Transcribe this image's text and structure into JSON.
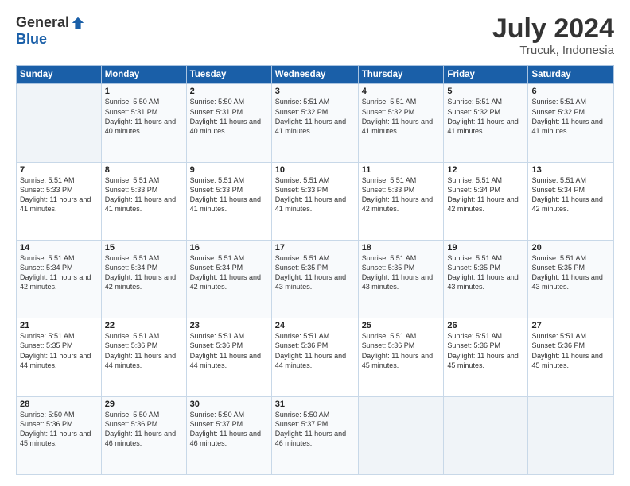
{
  "header": {
    "logo_general": "General",
    "logo_blue": "Blue",
    "month_year": "July 2024",
    "location": "Trucuk, Indonesia"
  },
  "weekdays": [
    "Sunday",
    "Monday",
    "Tuesday",
    "Wednesday",
    "Thursday",
    "Friday",
    "Saturday"
  ],
  "weeks": [
    [
      {
        "day": "",
        "sunrise": "",
        "sunset": "",
        "daylight": ""
      },
      {
        "day": "1",
        "sunrise": "Sunrise: 5:50 AM",
        "sunset": "Sunset: 5:31 PM",
        "daylight": "Daylight: 11 hours and 40 minutes."
      },
      {
        "day": "2",
        "sunrise": "Sunrise: 5:50 AM",
        "sunset": "Sunset: 5:31 PM",
        "daylight": "Daylight: 11 hours and 40 minutes."
      },
      {
        "day": "3",
        "sunrise": "Sunrise: 5:51 AM",
        "sunset": "Sunset: 5:32 PM",
        "daylight": "Daylight: 11 hours and 41 minutes."
      },
      {
        "day": "4",
        "sunrise": "Sunrise: 5:51 AM",
        "sunset": "Sunset: 5:32 PM",
        "daylight": "Daylight: 11 hours and 41 minutes."
      },
      {
        "day": "5",
        "sunrise": "Sunrise: 5:51 AM",
        "sunset": "Sunset: 5:32 PM",
        "daylight": "Daylight: 11 hours and 41 minutes."
      },
      {
        "day": "6",
        "sunrise": "Sunrise: 5:51 AM",
        "sunset": "Sunset: 5:32 PM",
        "daylight": "Daylight: 11 hours and 41 minutes."
      }
    ],
    [
      {
        "day": "7",
        "sunrise": "Sunrise: 5:51 AM",
        "sunset": "Sunset: 5:33 PM",
        "daylight": "Daylight: 11 hours and 41 minutes."
      },
      {
        "day": "8",
        "sunrise": "Sunrise: 5:51 AM",
        "sunset": "Sunset: 5:33 PM",
        "daylight": "Daylight: 11 hours and 41 minutes."
      },
      {
        "day": "9",
        "sunrise": "Sunrise: 5:51 AM",
        "sunset": "Sunset: 5:33 PM",
        "daylight": "Daylight: 11 hours and 41 minutes."
      },
      {
        "day": "10",
        "sunrise": "Sunrise: 5:51 AM",
        "sunset": "Sunset: 5:33 PM",
        "daylight": "Daylight: 11 hours and 41 minutes."
      },
      {
        "day": "11",
        "sunrise": "Sunrise: 5:51 AM",
        "sunset": "Sunset: 5:33 PM",
        "daylight": "Daylight: 11 hours and 42 minutes."
      },
      {
        "day": "12",
        "sunrise": "Sunrise: 5:51 AM",
        "sunset": "Sunset: 5:34 PM",
        "daylight": "Daylight: 11 hours and 42 minutes."
      },
      {
        "day": "13",
        "sunrise": "Sunrise: 5:51 AM",
        "sunset": "Sunset: 5:34 PM",
        "daylight": "Daylight: 11 hours and 42 minutes."
      }
    ],
    [
      {
        "day": "14",
        "sunrise": "Sunrise: 5:51 AM",
        "sunset": "Sunset: 5:34 PM",
        "daylight": "Daylight: 11 hours and 42 minutes."
      },
      {
        "day": "15",
        "sunrise": "Sunrise: 5:51 AM",
        "sunset": "Sunset: 5:34 PM",
        "daylight": "Daylight: 11 hours and 42 minutes."
      },
      {
        "day": "16",
        "sunrise": "Sunrise: 5:51 AM",
        "sunset": "Sunset: 5:34 PM",
        "daylight": "Daylight: 11 hours and 42 minutes."
      },
      {
        "day": "17",
        "sunrise": "Sunrise: 5:51 AM",
        "sunset": "Sunset: 5:35 PM",
        "daylight": "Daylight: 11 hours and 43 minutes."
      },
      {
        "day": "18",
        "sunrise": "Sunrise: 5:51 AM",
        "sunset": "Sunset: 5:35 PM",
        "daylight": "Daylight: 11 hours and 43 minutes."
      },
      {
        "day": "19",
        "sunrise": "Sunrise: 5:51 AM",
        "sunset": "Sunset: 5:35 PM",
        "daylight": "Daylight: 11 hours and 43 minutes."
      },
      {
        "day": "20",
        "sunrise": "Sunrise: 5:51 AM",
        "sunset": "Sunset: 5:35 PM",
        "daylight": "Daylight: 11 hours and 43 minutes."
      }
    ],
    [
      {
        "day": "21",
        "sunrise": "Sunrise: 5:51 AM",
        "sunset": "Sunset: 5:35 PM",
        "daylight": "Daylight: 11 hours and 44 minutes."
      },
      {
        "day": "22",
        "sunrise": "Sunrise: 5:51 AM",
        "sunset": "Sunset: 5:36 PM",
        "daylight": "Daylight: 11 hours and 44 minutes."
      },
      {
        "day": "23",
        "sunrise": "Sunrise: 5:51 AM",
        "sunset": "Sunset: 5:36 PM",
        "daylight": "Daylight: 11 hours and 44 minutes."
      },
      {
        "day": "24",
        "sunrise": "Sunrise: 5:51 AM",
        "sunset": "Sunset: 5:36 PM",
        "daylight": "Daylight: 11 hours and 44 minutes."
      },
      {
        "day": "25",
        "sunrise": "Sunrise: 5:51 AM",
        "sunset": "Sunset: 5:36 PM",
        "daylight": "Daylight: 11 hours and 45 minutes."
      },
      {
        "day": "26",
        "sunrise": "Sunrise: 5:51 AM",
        "sunset": "Sunset: 5:36 PM",
        "daylight": "Daylight: 11 hours and 45 minutes."
      },
      {
        "day": "27",
        "sunrise": "Sunrise: 5:51 AM",
        "sunset": "Sunset: 5:36 PM",
        "daylight": "Daylight: 11 hours and 45 minutes."
      }
    ],
    [
      {
        "day": "28",
        "sunrise": "Sunrise: 5:50 AM",
        "sunset": "Sunset: 5:36 PM",
        "daylight": "Daylight: 11 hours and 45 minutes."
      },
      {
        "day": "29",
        "sunrise": "Sunrise: 5:50 AM",
        "sunset": "Sunset: 5:36 PM",
        "daylight": "Daylight: 11 hours and 46 minutes."
      },
      {
        "day": "30",
        "sunrise": "Sunrise: 5:50 AM",
        "sunset": "Sunset: 5:37 PM",
        "daylight": "Daylight: 11 hours and 46 minutes."
      },
      {
        "day": "31",
        "sunrise": "Sunrise: 5:50 AM",
        "sunset": "Sunset: 5:37 PM",
        "daylight": "Daylight: 11 hours and 46 minutes."
      },
      {
        "day": "",
        "sunrise": "",
        "sunset": "",
        "daylight": ""
      },
      {
        "day": "",
        "sunrise": "",
        "sunset": "",
        "daylight": ""
      },
      {
        "day": "",
        "sunrise": "",
        "sunset": "",
        "daylight": ""
      }
    ]
  ]
}
